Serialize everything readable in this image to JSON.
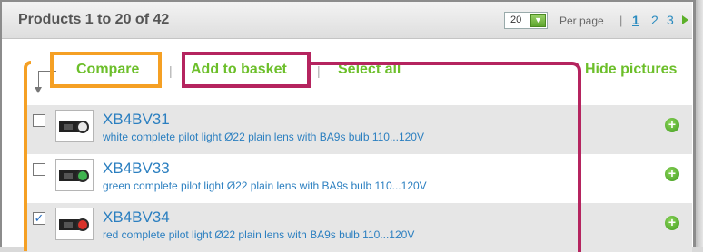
{
  "header": {
    "title": "Products 1 to 20 of 42",
    "per_page_value": "20",
    "per_page_label": "Per page",
    "separator": "|",
    "pages": [
      "1",
      "2",
      "3"
    ]
  },
  "actions": {
    "compare": "Compare",
    "separator": "|",
    "add_to_basket": "Add to basket",
    "select_all": "Select all",
    "hide_pictures": "Hide pictures"
  },
  "products": [
    {
      "ref": "XB4BV31",
      "description": "white complete pilot light Ø22 plain lens with BA9s bulb 110...120V",
      "checked": false
    },
    {
      "ref": "XB4BV33",
      "description": "green complete pilot light Ø22 plain lens with BA9s bulb 110...120V",
      "checked": false
    },
    {
      "ref": "XB4BV34",
      "description": "red complete pilot light Ø22 plain lens with BA9s bulb 110...120V",
      "checked": true
    }
  ],
  "colors": {
    "accent_green": "#6cbf2a",
    "link_blue": "#2b7fc0",
    "highlight_orange": "#f5a024",
    "highlight_magenta": "#b5245f"
  },
  "icons": {
    "per_page_dropdown": "chevron-down-icon",
    "next_page": "arrow-right-icon",
    "add_item": "plus-circle-icon",
    "checkbox_checked": "checkmark-icon"
  }
}
